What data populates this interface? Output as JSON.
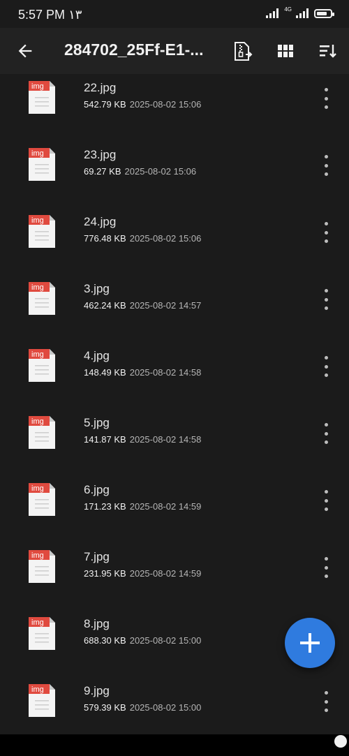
{
  "status_bar": {
    "time": "5:57 PM",
    "extra": "١٣",
    "network": "4G",
    "battery_level": 0.8
  },
  "toolbar": {
    "title": "284702_25Ff-E1-...",
    "icons": [
      "back-arrow-icon",
      "zip-extract-icon",
      "grid-view-icon",
      "sort-icon"
    ]
  },
  "files": [
    {
      "icon_label": "img",
      "name": "22.jpg",
      "size": "542.79 KB",
      "date": "2025-08-02 15:06"
    },
    {
      "icon_label": "img",
      "name": "23.jpg",
      "size": "69.27 KB",
      "date": "2025-08-02 15:06"
    },
    {
      "icon_label": "img",
      "name": "24.jpg",
      "size": "776.48 KB",
      "date": "2025-08-02 15:06"
    },
    {
      "icon_label": "img",
      "name": "3.jpg",
      "size": "462.24 KB",
      "date": "2025-08-02 14:57"
    },
    {
      "icon_label": "img",
      "name": "4.jpg",
      "size": "148.49 KB",
      "date": "2025-08-02 14:58"
    },
    {
      "icon_label": "img",
      "name": "5.jpg",
      "size": "141.87 KB",
      "date": "2025-08-02 14:58"
    },
    {
      "icon_label": "img",
      "name": "6.jpg",
      "size": "171.23 KB",
      "date": "2025-08-02 14:59"
    },
    {
      "icon_label": "img",
      "name": "7.jpg",
      "size": "231.95 KB",
      "date": "2025-08-02 14:59"
    },
    {
      "icon_label": "img",
      "name": "8.jpg",
      "size": "688.30 KB",
      "date": "2025-08-02 15:00"
    },
    {
      "icon_label": "img",
      "name": "9.jpg",
      "size": "579.39 KB",
      "date": "2025-08-02 15:00"
    }
  ],
  "colors": {
    "background": "#1b1b1b",
    "toolbar": "#222222",
    "fab": "#2f7bdf",
    "file_icon_badge": "#e04a3f"
  }
}
